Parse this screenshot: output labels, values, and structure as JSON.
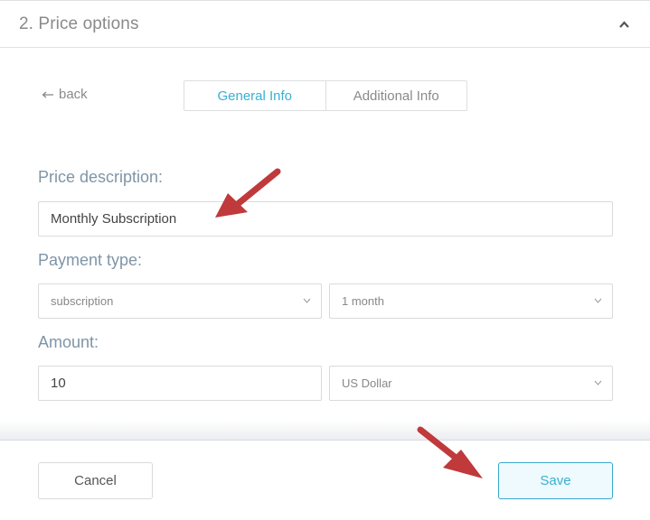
{
  "header": {
    "title": "2. Price options",
    "collapse_icon": "chevron-up-icon"
  },
  "nav": {
    "back_label": "back",
    "back_icon": "arrow-left-icon",
    "tabs": [
      {
        "label": "General Info",
        "active": true
      },
      {
        "label": "Additional Info",
        "active": false
      }
    ]
  },
  "form": {
    "price_description": {
      "label": "Price description:",
      "value": "Monthly Subscription"
    },
    "payment_type": {
      "label": "Payment type:",
      "type_value": "subscription",
      "period_value": "1 month"
    },
    "amount": {
      "label": "Amount:",
      "value": "10",
      "currency_value": "US Dollar"
    }
  },
  "footer": {
    "cancel_label": "Cancel",
    "save_label": "Save"
  },
  "annotations": {
    "arrow_color": "#c0393b",
    "accent_color": "#3aafd3"
  }
}
